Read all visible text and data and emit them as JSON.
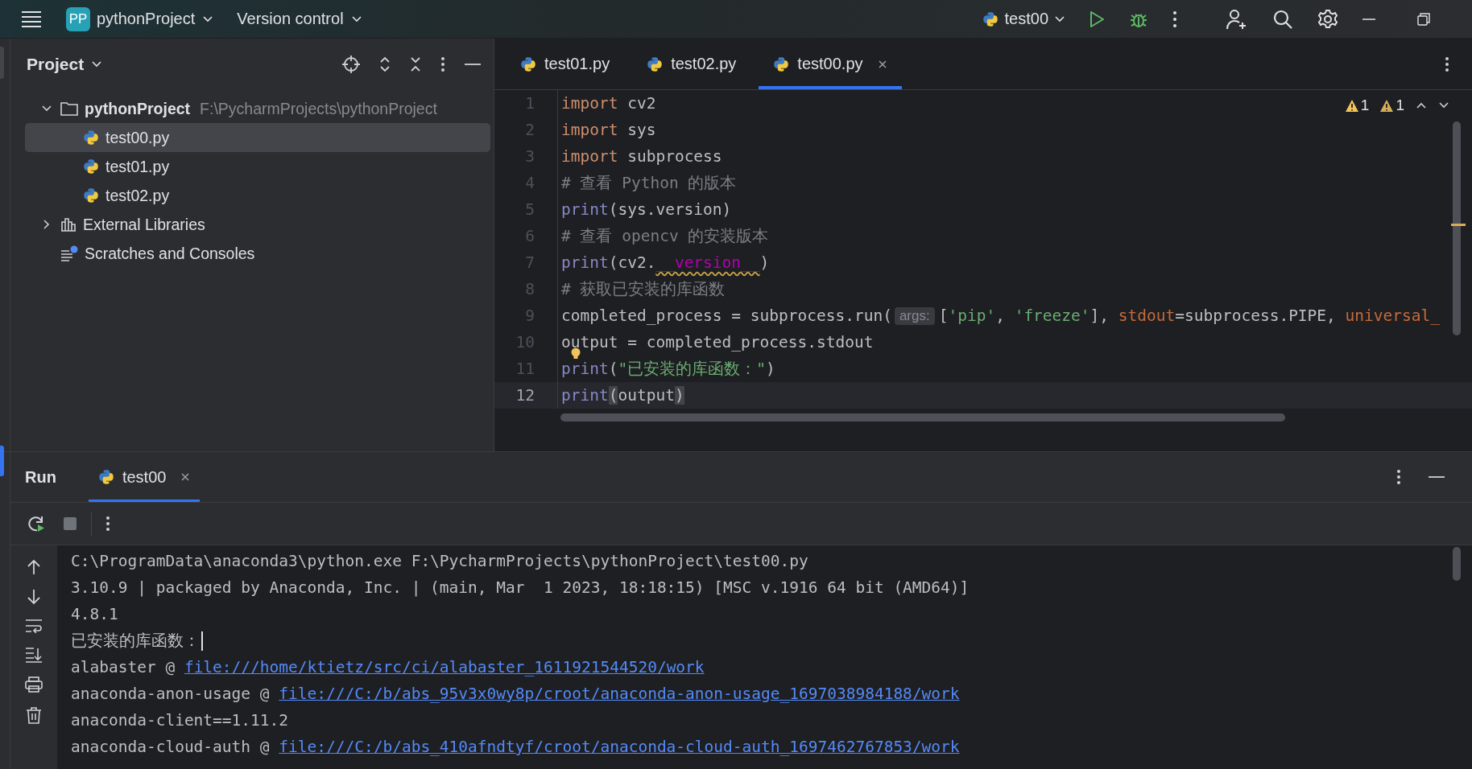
{
  "top_bar": {
    "project_badge": "PP",
    "project": "pythonProject",
    "vcs": "Version control",
    "run_config": "test00"
  },
  "project_panel": {
    "title": "Project",
    "tree": [
      {
        "label": "pythonProject",
        "path": "F:\\PycharmProjects\\pythonProject",
        "kind": "folder",
        "expanded": true,
        "selected": false,
        "children": [
          {
            "label": "test00.py",
            "kind": "python",
            "selected": true
          },
          {
            "label": "test01.py",
            "kind": "python",
            "selected": false
          },
          {
            "label": "test02.py",
            "kind": "python",
            "selected": false
          }
        ]
      },
      {
        "label": "External Libraries",
        "kind": "library",
        "expanded": false,
        "selected": false
      },
      {
        "label": "Scratches and Consoles",
        "kind": "scratches",
        "selected": false
      }
    ]
  },
  "editor": {
    "tabs": [
      {
        "label": "test01.py",
        "selected": false
      },
      {
        "label": "test02.py",
        "selected": false
      },
      {
        "label": "test00.py",
        "selected": true
      }
    ],
    "inspections": [
      {
        "kind": "warning",
        "count": "1"
      },
      {
        "kind": "weak_warning",
        "count": "1"
      }
    ],
    "lines": [
      {
        "number": "1",
        "current": false,
        "tokens": [
          {
            "kind": "keyword",
            "text": "import"
          },
          {
            "kind": "plain",
            "text": " cv2"
          }
        ]
      },
      {
        "number": "2",
        "current": false,
        "tokens": [
          {
            "kind": "keyword",
            "text": "import"
          },
          {
            "kind": "plain",
            "text": " sys"
          }
        ]
      },
      {
        "number": "3",
        "current": false,
        "tokens": [
          {
            "kind": "keyword",
            "text": "import"
          },
          {
            "kind": "plain",
            "text": " subprocess"
          }
        ]
      },
      {
        "number": "4",
        "current": false,
        "tokens": [
          {
            "kind": "comment",
            "text": "# 查看 Python 的版本"
          }
        ]
      },
      {
        "number": "5",
        "current": false,
        "tokens": [
          {
            "kind": "builtin",
            "text": "print"
          },
          {
            "kind": "plain",
            "text": "(sys.version)"
          }
        ]
      },
      {
        "number": "6",
        "current": false,
        "tokens": [
          {
            "kind": "comment",
            "text": "# 查看 opencv 的安装版本"
          }
        ]
      },
      {
        "number": "7",
        "current": false,
        "tokens": [
          {
            "kind": "builtin",
            "text": "print"
          },
          {
            "kind": "plain",
            "text": "(cv2."
          },
          {
            "kind": "dunder",
            "text": "__version__"
          },
          {
            "kind": "plain",
            "text": ")"
          }
        ]
      },
      {
        "number": "8",
        "current": false,
        "tokens": [
          {
            "kind": "comment",
            "text": "# 获取已安装的库函数"
          }
        ]
      },
      {
        "number": "9",
        "current": false,
        "tokens": [
          {
            "kind": "plain",
            "text": "completed_process = subprocess.run("
          },
          {
            "kind": "hint",
            "text": "args:"
          },
          {
            "kind": "plain",
            "text": "["
          },
          {
            "kind": "string",
            "text": "'pip'"
          },
          {
            "kind": "plain",
            "text": ", "
          },
          {
            "kind": "string",
            "text": "'freeze'"
          },
          {
            "kind": "plain",
            "text": "], "
          },
          {
            "kind": "param",
            "text": "stdout"
          },
          {
            "kind": "plain",
            "text": "=subprocess.PIPE, "
          },
          {
            "kind": "param",
            "text": "universal_"
          }
        ]
      },
      {
        "number": "10",
        "current": false,
        "tokens": [
          {
            "kind": "plain",
            "text": "output = completed_process.stdout"
          }
        ]
      },
      {
        "number": "11",
        "current": false,
        "bulb": true,
        "tokens": [
          {
            "kind": "builtin",
            "text": "print"
          },
          {
            "kind": "plain",
            "text": "("
          },
          {
            "kind": "string",
            "text": "\"已安装的库函数：\""
          },
          {
            "kind": "plain",
            "text": ")"
          }
        ]
      },
      {
        "number": "12",
        "current": true,
        "tokens": [
          {
            "kind": "builtin",
            "text": "print"
          },
          {
            "kind": "bracket",
            "text": "("
          },
          {
            "kind": "plain",
            "text": "output"
          },
          {
            "kind": "bracket",
            "text": ")"
          }
        ]
      }
    ]
  },
  "run_panel": {
    "title": "Run",
    "tabs": [
      {
        "label": "test00",
        "selected": true
      }
    ],
    "console": [
      {
        "segments": [
          {
            "kind": "text",
            "text": "C:\\ProgramData\\anaconda3\\python.exe F:\\PycharmProjects\\pythonProject\\test00.py"
          }
        ]
      },
      {
        "segments": [
          {
            "kind": "text",
            "text": "3.10.9 | packaged by Anaconda, Inc. | (main, Mar  1 2023, 18:18:15) [MSC v.1916 64 bit (AMD64)]"
          }
        ]
      },
      {
        "segments": [
          {
            "kind": "text",
            "text": "4.8.1"
          }
        ]
      },
      {
        "segments": [
          {
            "kind": "text",
            "text": "已安装的库函数："
          },
          {
            "kind": "cursor"
          }
        ]
      },
      {
        "segments": [
          {
            "kind": "text",
            "text": "alabaster @ "
          },
          {
            "kind": "link",
            "text": "file:///home/ktietz/src/ci/alabaster_1611921544520/work"
          }
        ]
      },
      {
        "segments": [
          {
            "kind": "text",
            "text": "anaconda-anon-usage @ "
          },
          {
            "kind": "link",
            "text": "file:///C:/b/abs_95v3x0wy8p/croot/anaconda-anon-usage_1697038984188/work"
          }
        ]
      },
      {
        "segments": [
          {
            "kind": "text",
            "text": "anaconda-client==1.11.2"
          }
        ]
      },
      {
        "segments": [
          {
            "kind": "text",
            "text": "anaconda-cloud-auth @ "
          },
          {
            "kind": "link",
            "text": "file:///C:/b/abs_410afndtyf/croot/anaconda-cloud-auth_1697462767853/work"
          }
        ]
      }
    ]
  }
}
